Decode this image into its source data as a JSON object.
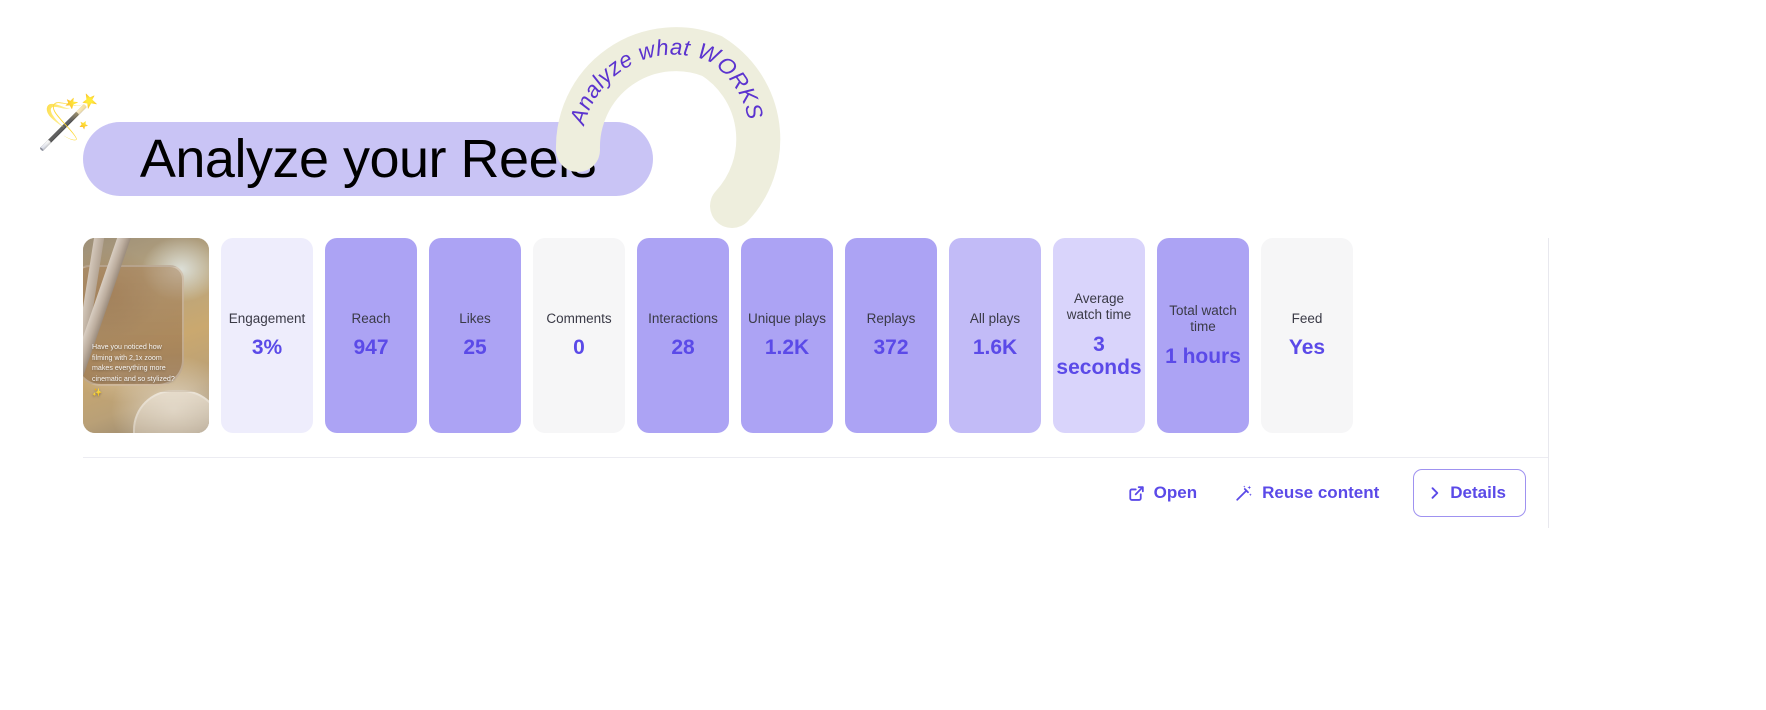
{
  "header": {
    "wand_icon": "magic-wand-emoji",
    "title": "Analyze your Reels",
    "arc_badge_text": "Analyze what WORKS",
    "pill_color": "#c9c4f5",
    "arc_color": "#eeeedd",
    "arc_text_color": "#5b33cf"
  },
  "thumbnail": {
    "caption_line1": "Have you noticed how",
    "caption_line2": "filming with 2,1x zoom",
    "caption_line3": "makes everything more",
    "caption_line4": "cinematic and so stylized?",
    "caption_emoji": "✨"
  },
  "metrics": [
    {
      "label": "Engagement",
      "value": "3%",
      "tone": "lightest"
    },
    {
      "label": "Reach",
      "value": "947",
      "tone": "strong"
    },
    {
      "label": "Likes",
      "value": "25",
      "tone": "strong"
    },
    {
      "label": "Comments",
      "value": "0",
      "tone": "grey"
    },
    {
      "label": "Interactions",
      "value": "28",
      "tone": "strong"
    },
    {
      "label": "Unique plays",
      "value": "1.2K",
      "tone": "strong"
    },
    {
      "label": "Replays",
      "value": "372",
      "tone": "strong"
    },
    {
      "label": "All plays",
      "value": "1.6K",
      "tone": "medium"
    },
    {
      "label": "Average watch time",
      "value": "3 seconds",
      "tone": "pale"
    },
    {
      "label": "Total watch time",
      "value": "1 hours",
      "tone": "strong"
    },
    {
      "label": "Feed",
      "value": "Yes",
      "tone": "grey"
    }
  ],
  "actions": {
    "open_label": "Open",
    "reuse_label": "Reuse content",
    "details_label": "Details"
  },
  "colors": {
    "accent": "#5b4ae8",
    "card_strong": "#aca3f4",
    "card_medium": "#c2bbf7",
    "card_pale": "#d9d4fb",
    "card_lightest": "#eeedfc",
    "card_grey": "#f6f6f7",
    "label_text": "#3a3a46"
  }
}
